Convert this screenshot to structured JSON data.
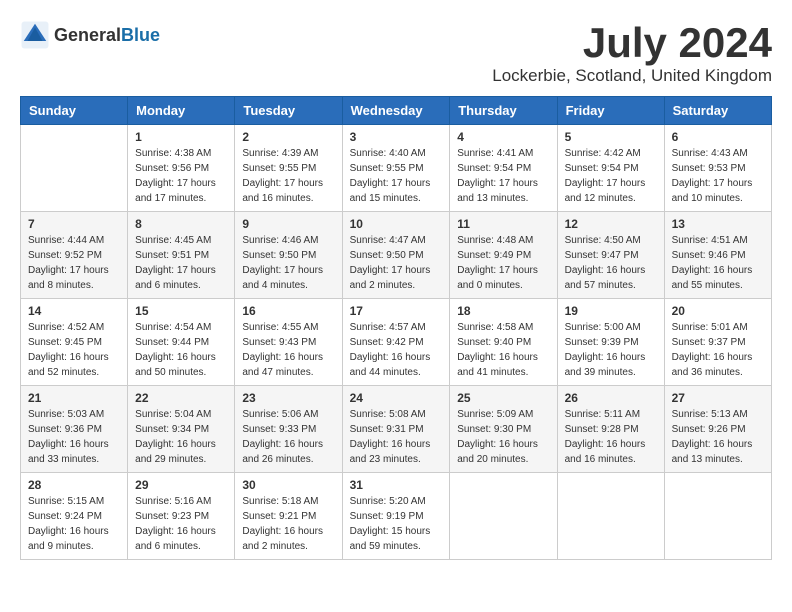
{
  "header": {
    "logo_general": "General",
    "logo_blue": "Blue",
    "title": "July 2024",
    "location": "Lockerbie, Scotland, United Kingdom"
  },
  "weekdays": [
    "Sunday",
    "Monday",
    "Tuesday",
    "Wednesday",
    "Thursday",
    "Friday",
    "Saturday"
  ],
  "weeks": [
    [
      {
        "day": "",
        "sunrise": "",
        "sunset": "",
        "daylight": ""
      },
      {
        "day": "1",
        "sunrise": "Sunrise: 4:38 AM",
        "sunset": "Sunset: 9:56 PM",
        "daylight": "Daylight: 17 hours and 17 minutes."
      },
      {
        "day": "2",
        "sunrise": "Sunrise: 4:39 AM",
        "sunset": "Sunset: 9:55 PM",
        "daylight": "Daylight: 17 hours and 16 minutes."
      },
      {
        "day": "3",
        "sunrise": "Sunrise: 4:40 AM",
        "sunset": "Sunset: 9:55 PM",
        "daylight": "Daylight: 17 hours and 15 minutes."
      },
      {
        "day": "4",
        "sunrise": "Sunrise: 4:41 AM",
        "sunset": "Sunset: 9:54 PM",
        "daylight": "Daylight: 17 hours and 13 minutes."
      },
      {
        "day": "5",
        "sunrise": "Sunrise: 4:42 AM",
        "sunset": "Sunset: 9:54 PM",
        "daylight": "Daylight: 17 hours and 12 minutes."
      },
      {
        "day": "6",
        "sunrise": "Sunrise: 4:43 AM",
        "sunset": "Sunset: 9:53 PM",
        "daylight": "Daylight: 17 hours and 10 minutes."
      }
    ],
    [
      {
        "day": "7",
        "sunrise": "Sunrise: 4:44 AM",
        "sunset": "Sunset: 9:52 PM",
        "daylight": "Daylight: 17 hours and 8 minutes."
      },
      {
        "day": "8",
        "sunrise": "Sunrise: 4:45 AM",
        "sunset": "Sunset: 9:51 PM",
        "daylight": "Daylight: 17 hours and 6 minutes."
      },
      {
        "day": "9",
        "sunrise": "Sunrise: 4:46 AM",
        "sunset": "Sunset: 9:50 PM",
        "daylight": "Daylight: 17 hours and 4 minutes."
      },
      {
        "day": "10",
        "sunrise": "Sunrise: 4:47 AM",
        "sunset": "Sunset: 9:50 PM",
        "daylight": "Daylight: 17 hours and 2 minutes."
      },
      {
        "day": "11",
        "sunrise": "Sunrise: 4:48 AM",
        "sunset": "Sunset: 9:49 PM",
        "daylight": "Daylight: 17 hours and 0 minutes."
      },
      {
        "day": "12",
        "sunrise": "Sunrise: 4:50 AM",
        "sunset": "Sunset: 9:47 PM",
        "daylight": "Daylight: 16 hours and 57 minutes."
      },
      {
        "day": "13",
        "sunrise": "Sunrise: 4:51 AM",
        "sunset": "Sunset: 9:46 PM",
        "daylight": "Daylight: 16 hours and 55 minutes."
      }
    ],
    [
      {
        "day": "14",
        "sunrise": "Sunrise: 4:52 AM",
        "sunset": "Sunset: 9:45 PM",
        "daylight": "Daylight: 16 hours and 52 minutes."
      },
      {
        "day": "15",
        "sunrise": "Sunrise: 4:54 AM",
        "sunset": "Sunset: 9:44 PM",
        "daylight": "Daylight: 16 hours and 50 minutes."
      },
      {
        "day": "16",
        "sunrise": "Sunrise: 4:55 AM",
        "sunset": "Sunset: 9:43 PM",
        "daylight": "Daylight: 16 hours and 47 minutes."
      },
      {
        "day": "17",
        "sunrise": "Sunrise: 4:57 AM",
        "sunset": "Sunset: 9:42 PM",
        "daylight": "Daylight: 16 hours and 44 minutes."
      },
      {
        "day": "18",
        "sunrise": "Sunrise: 4:58 AM",
        "sunset": "Sunset: 9:40 PM",
        "daylight": "Daylight: 16 hours and 41 minutes."
      },
      {
        "day": "19",
        "sunrise": "Sunrise: 5:00 AM",
        "sunset": "Sunset: 9:39 PM",
        "daylight": "Daylight: 16 hours and 39 minutes."
      },
      {
        "day": "20",
        "sunrise": "Sunrise: 5:01 AM",
        "sunset": "Sunset: 9:37 PM",
        "daylight": "Daylight: 16 hours and 36 minutes."
      }
    ],
    [
      {
        "day": "21",
        "sunrise": "Sunrise: 5:03 AM",
        "sunset": "Sunset: 9:36 PM",
        "daylight": "Daylight: 16 hours and 33 minutes."
      },
      {
        "day": "22",
        "sunrise": "Sunrise: 5:04 AM",
        "sunset": "Sunset: 9:34 PM",
        "daylight": "Daylight: 16 hours and 29 minutes."
      },
      {
        "day": "23",
        "sunrise": "Sunrise: 5:06 AM",
        "sunset": "Sunset: 9:33 PM",
        "daylight": "Daylight: 16 hours and 26 minutes."
      },
      {
        "day": "24",
        "sunrise": "Sunrise: 5:08 AM",
        "sunset": "Sunset: 9:31 PM",
        "daylight": "Daylight: 16 hours and 23 minutes."
      },
      {
        "day": "25",
        "sunrise": "Sunrise: 5:09 AM",
        "sunset": "Sunset: 9:30 PM",
        "daylight": "Daylight: 16 hours and 20 minutes."
      },
      {
        "day": "26",
        "sunrise": "Sunrise: 5:11 AM",
        "sunset": "Sunset: 9:28 PM",
        "daylight": "Daylight: 16 hours and 16 minutes."
      },
      {
        "day": "27",
        "sunrise": "Sunrise: 5:13 AM",
        "sunset": "Sunset: 9:26 PM",
        "daylight": "Daylight: 16 hours and 13 minutes."
      }
    ],
    [
      {
        "day": "28",
        "sunrise": "Sunrise: 5:15 AM",
        "sunset": "Sunset: 9:24 PM",
        "daylight": "Daylight: 16 hours and 9 minutes."
      },
      {
        "day": "29",
        "sunrise": "Sunrise: 5:16 AM",
        "sunset": "Sunset: 9:23 PM",
        "daylight": "Daylight: 16 hours and 6 minutes."
      },
      {
        "day": "30",
        "sunrise": "Sunrise: 5:18 AM",
        "sunset": "Sunset: 9:21 PM",
        "daylight": "Daylight: 16 hours and 2 minutes."
      },
      {
        "day": "31",
        "sunrise": "Sunrise: 5:20 AM",
        "sunset": "Sunset: 9:19 PM",
        "daylight": "Daylight: 15 hours and 59 minutes."
      },
      {
        "day": "",
        "sunrise": "",
        "sunset": "",
        "daylight": ""
      },
      {
        "day": "",
        "sunrise": "",
        "sunset": "",
        "daylight": ""
      },
      {
        "day": "",
        "sunrise": "",
        "sunset": "",
        "daylight": ""
      }
    ]
  ]
}
